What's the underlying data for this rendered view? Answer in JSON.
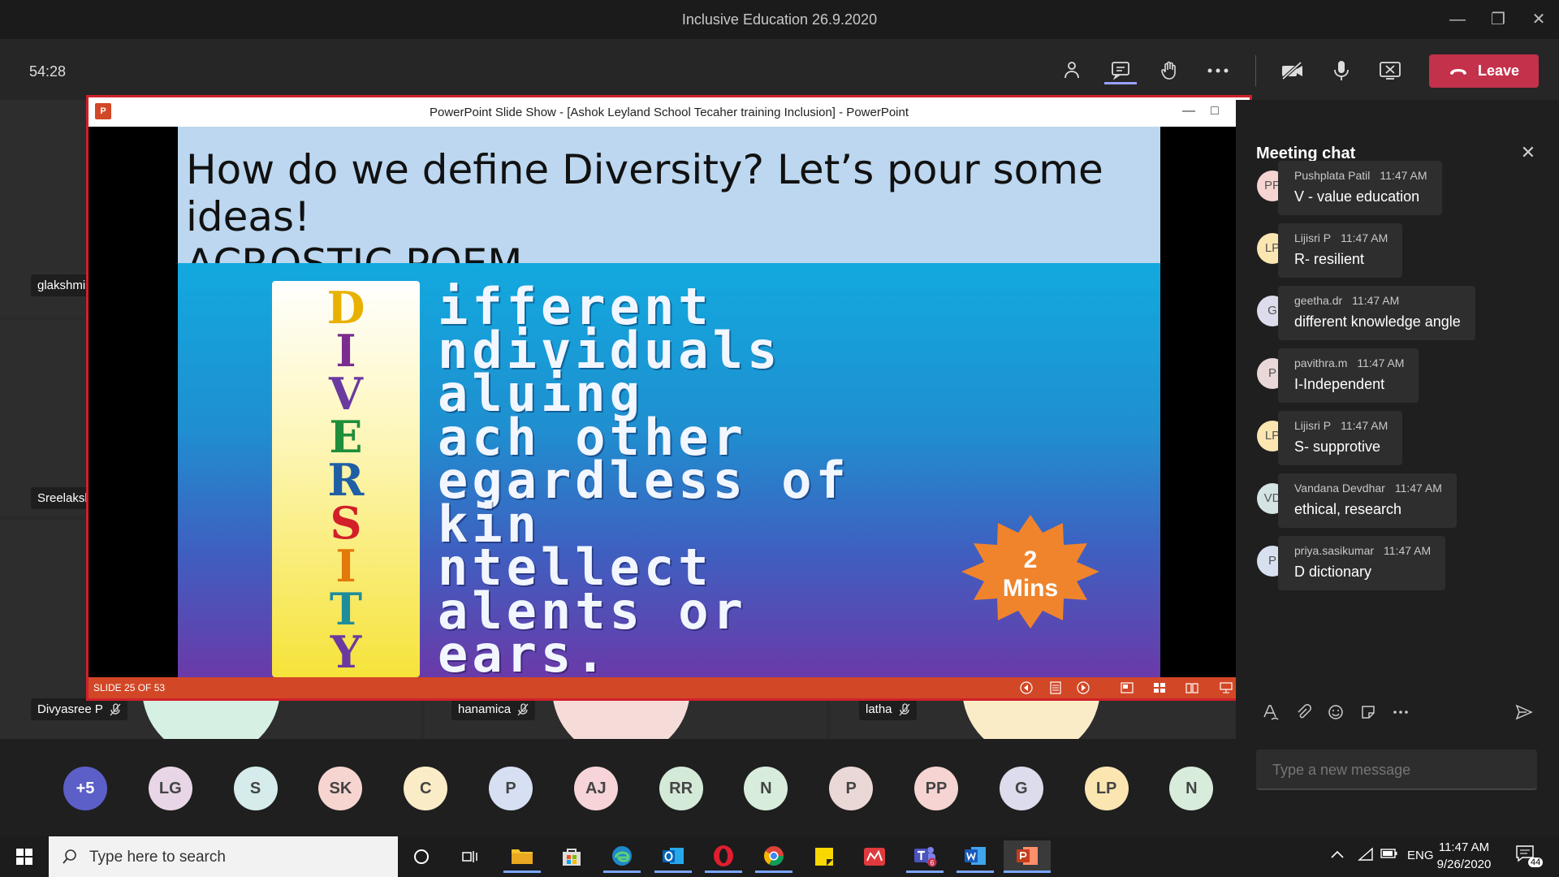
{
  "window": {
    "title": "Inclusive Education 26.9.2020"
  },
  "toolbar": {
    "timer": "54:28",
    "leave_label": "Leave"
  },
  "stage_tiles": [
    {
      "name": "glakshmi"
    },
    {
      "name": "Sreelaksl"
    },
    {
      "name": "Divyasree P"
    },
    {
      "name": "hanamica"
    },
    {
      "name": "latha"
    }
  ],
  "ppt": {
    "window_title": "PowerPoint Slide Show - [Ashok Leyland School Tecaher training Inclusion] - PowerPoint",
    "logo": "P",
    "slide_status": "SLIDE 25 OF 53",
    "slide": {
      "title_line1": "How do we define Diversity? Let’s pour some ideas!",
      "title_line2": "ACROSTIC POEM",
      "letters": [
        "D",
        "I",
        "V",
        "E",
        "R",
        "S",
        "I",
        "T",
        "Y"
      ],
      "letter_colors": [
        "#e8b100",
        "#7a2c8f",
        "#6a3aa0",
        "#1f8d3a",
        "#1f5fa6",
        "#d21f2a",
        "#e3780c",
        "#1f8d9c",
        "#6a3aa0"
      ],
      "words": [
        "ifferent",
        "ndividuals",
        "aluing",
        "ach other",
        "egardless of",
        "kin",
        "ntellect",
        "alents or",
        "ears."
      ],
      "badge_number": "2",
      "badge_unit": "Mins"
    }
  },
  "chat": {
    "title": "Meeting chat",
    "messages": [
      {
        "initials": "PP",
        "sender": "Pushplata Patil",
        "time": "11:47 AM",
        "text": "V - value education",
        "avatar_color": "#f6d4d2"
      },
      {
        "initials": "LP",
        "sender": "Lijisri P",
        "time": "11:47 AM",
        "text": "R- resilient",
        "avatar_color": "#fbe6b2"
      },
      {
        "initials": "G",
        "sender": "geetha.dr",
        "time": "11:47 AM",
        "text": "different knowledge angle",
        "avatar_color": "#dcdcec"
      },
      {
        "initials": "P",
        "sender": "pavithra.m",
        "time": "11:47 AM",
        "text": "I-Independent",
        "avatar_color": "#ead8d8"
      },
      {
        "initials": "LP",
        "sender": "Lijisri P",
        "time": "11:47 AM",
        "text": "S- supprotive",
        "avatar_color": "#fbe6b2"
      },
      {
        "initials": "VD",
        "sender": "Vandana Devdhar",
        "time": "11:47 AM",
        "text": "ethical, research",
        "avatar_color": "#d4e4e4"
      },
      {
        "initials": "P",
        "sender": "priya.sasikumar",
        "time": "11:47 AM",
        "text": "D dictionary",
        "avatar_color": "#d8e0f0"
      }
    ],
    "compose_placeholder": "Type a new message"
  },
  "participants": [
    {
      "initials": "+5",
      "color": "#5b5fc7",
      "text_color": "#ffffff"
    },
    {
      "initials": "LG",
      "color": "#e8d6e6",
      "text_color": "#444"
    },
    {
      "initials": "S",
      "color": "#d6ecec",
      "text_color": "#444"
    },
    {
      "initials": "SK",
      "color": "#f6d4d0",
      "text_color": "#444"
    },
    {
      "initials": "C",
      "color": "#fbecc8",
      "text_color": "#444"
    },
    {
      "initials": "P",
      "color": "#d6e0f2",
      "text_color": "#444"
    },
    {
      "initials": "AJ",
      "color": "#f6d4d8",
      "text_color": "#444"
    },
    {
      "initials": "RR",
      "color": "#d4ead8",
      "text_color": "#444"
    },
    {
      "initials": "N",
      "color": "#d8ecdc",
      "text_color": "#444"
    },
    {
      "initials": "P",
      "color": "#ead8d6",
      "text_color": "#444"
    },
    {
      "initials": "PP",
      "color": "#f6d4d2",
      "text_color": "#444"
    },
    {
      "initials": "G",
      "color": "#dcdcec",
      "text_color": "#444"
    },
    {
      "initials": "LP",
      "color": "#fbe6b2",
      "text_color": "#444"
    },
    {
      "initials": "N",
      "color": "#d8ecdc",
      "text_color": "#444"
    }
  ],
  "taskbar": {
    "search_placeholder": "Type here to search",
    "language": "ENG",
    "time": "11:47 AM",
    "date": "9/26/2020",
    "notification_count": "44",
    "teams_badge": "6"
  }
}
